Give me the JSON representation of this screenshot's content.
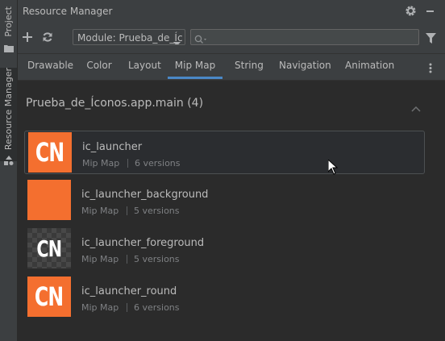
{
  "side": {
    "project_label": "Project",
    "resource_manager_label": "Resource Manager"
  },
  "window": {
    "title": "Resource Manager"
  },
  "toolbar": {
    "module_value": "Module: Prueba_de_Íc",
    "search_placeholder": ""
  },
  "tabs": [
    {
      "label": "Drawable"
    },
    {
      "label": "Color"
    },
    {
      "label": "Layout"
    },
    {
      "label": "Mip Map"
    },
    {
      "label": "String"
    },
    {
      "label": "Navigation"
    },
    {
      "label": "Animation"
    }
  ],
  "active_tab": "Mip Map",
  "group": {
    "title": "Prueba_de_Íconos.app.main (4)"
  },
  "resources": [
    {
      "name": "ic_launcher",
      "type": "Mip Map",
      "versions": "6 versions",
      "thumb_text": "CN",
      "thumb_style": "solid"
    },
    {
      "name": "ic_launcher_background",
      "type": "Mip Map",
      "versions": "5 versions",
      "thumb_text": "",
      "thumb_style": "solid"
    },
    {
      "name": "ic_launcher_foreground",
      "type": "Mip Map",
      "versions": "5 versions",
      "thumb_text": "CN",
      "thumb_style": "checker"
    },
    {
      "name": "ic_launcher_round",
      "type": "Mip Map",
      "versions": "6 versions",
      "thumb_text": "CN",
      "thumb_style": "solid"
    }
  ],
  "colors": {
    "accent": "#4a88c7",
    "icon_orange": "#f46f2f",
    "background": "#2b2b2b",
    "panel": "#3c3f41"
  },
  "icons": [
    "plus-icon",
    "refresh-icon",
    "gear-icon",
    "minimize-icon",
    "search-icon",
    "filter-icon",
    "more-icon",
    "chevron-up-icon",
    "folder-icon",
    "shapes-icon",
    "cursor-icon"
  ]
}
